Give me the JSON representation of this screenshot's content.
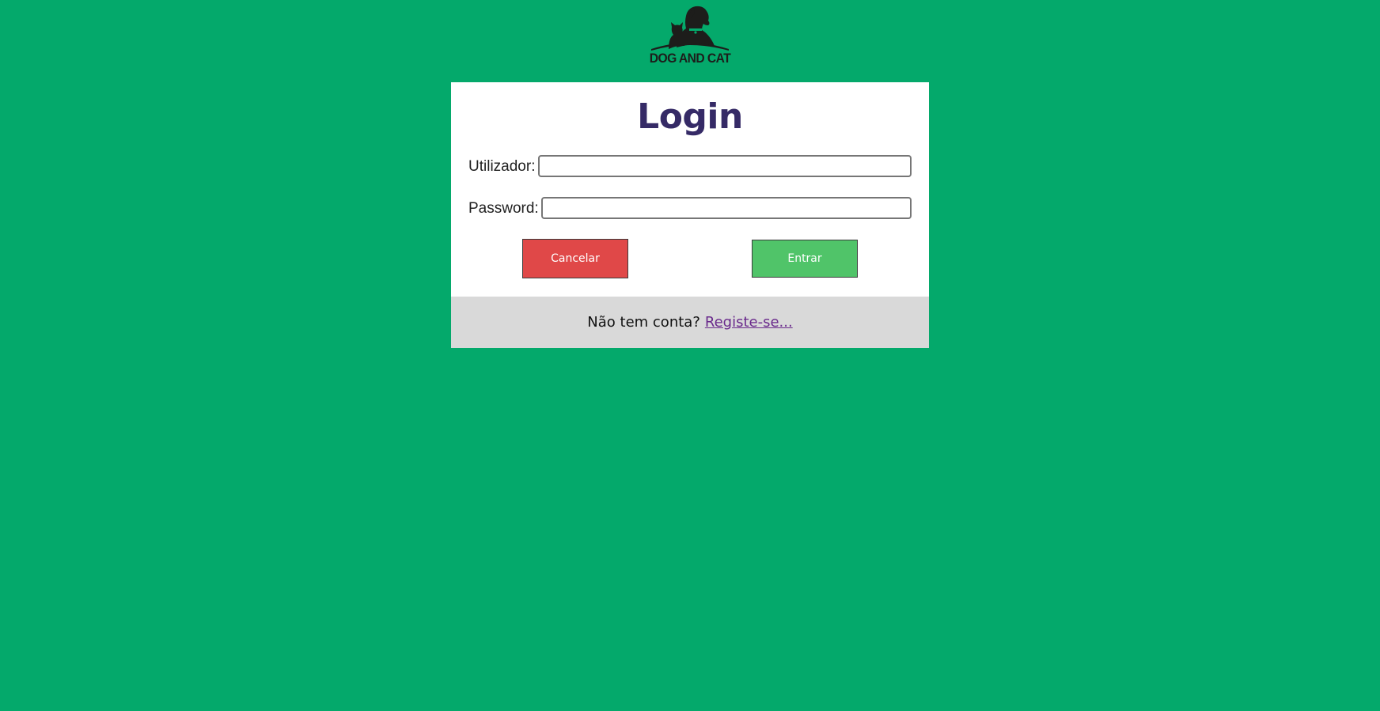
{
  "colors": {
    "background": "#04a96b",
    "title": "#352a66",
    "cancel_button": "#e04848",
    "enter_button": "#50c469",
    "footer_background": "#d9d9d9",
    "link": "#6a2a8c"
  },
  "logo": {
    "icon": "dog-and-cat-silhouette-icon",
    "text": "DOG AND CAT"
  },
  "login": {
    "title": "Login",
    "username_label": "Utilizador:",
    "username_value": "",
    "password_label": "Password:",
    "password_value": "",
    "cancel_label": "Cancelar",
    "enter_label": "Entrar"
  },
  "footer": {
    "prompt": "Não tem conta?",
    "register_link": "Registe-se..."
  }
}
